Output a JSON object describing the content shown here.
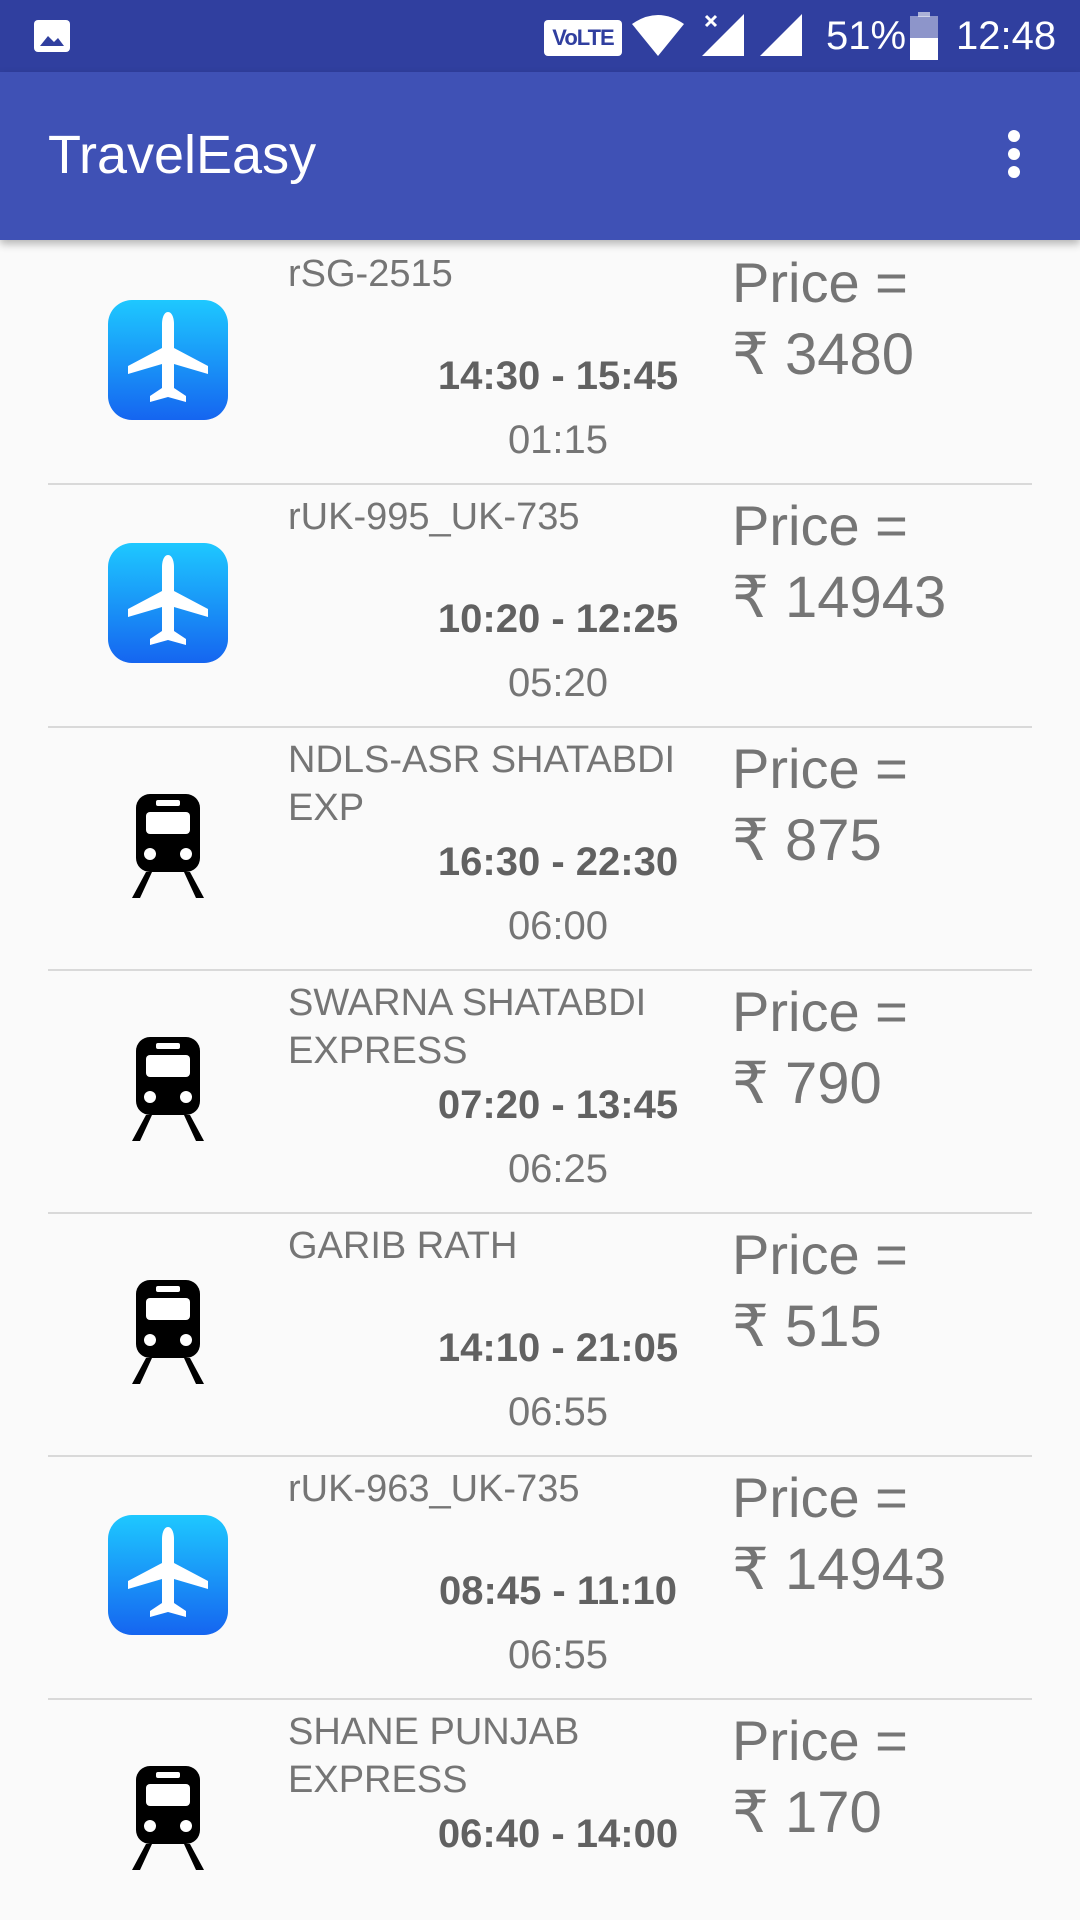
{
  "status_bar": {
    "volte": "VoLTE",
    "battery": "51%",
    "time": "12:48",
    "icons": [
      "gallery-icon",
      "wifi-icon",
      "cell-signal-icon",
      "cell-signal-icon",
      "battery-icon"
    ]
  },
  "app_bar": {
    "title": "TravelEasy",
    "menu_icon": "more-vert-icon"
  },
  "colors": {
    "status_bar": "#303f9f",
    "app_bar": "#3f51b5",
    "flight_icon_gradient": [
      "#1ec8ff",
      "#1565f0"
    ],
    "text_gray": "#757575"
  },
  "items": [
    {
      "type": "flight",
      "icon": "airplane-icon",
      "name": "rSG-2515",
      "time": "14:30 - 15:45",
      "duration": "01:15",
      "price_label": "Price =",
      "price": "₹ 3480"
    },
    {
      "type": "flight",
      "icon": "airplane-icon",
      "name": "rUK-995_UK-735",
      "time": "10:20 - 12:25",
      "duration": "05:20",
      "price_label": "Price =",
      "price": "₹ 14943"
    },
    {
      "type": "train",
      "icon": "train-icon",
      "name": "NDLS-ASR SHATABDI EXP",
      "time": "16:30 - 22:30",
      "duration": "06:00",
      "price_label": "Price =",
      "price": "₹ 875"
    },
    {
      "type": "train",
      "icon": "train-icon",
      "name": "SWARNA SHATABDI EXPRESS",
      "time": "07:20 - 13:45",
      "duration": "06:25",
      "price_label": "Price =",
      "price": "₹ 790"
    },
    {
      "type": "train",
      "icon": "train-icon",
      "name": "GARIB RATH",
      "time": "14:10 - 21:05",
      "duration": "06:55",
      "price_label": "Price =",
      "price": "₹ 515"
    },
    {
      "type": "flight",
      "icon": "airplane-icon",
      "name": "rUK-963_UK-735",
      "time": "08:45 - 11:10",
      "duration": "06:55",
      "price_label": "Price =",
      "price": "₹ 14943"
    },
    {
      "type": "train",
      "icon": "train-icon",
      "name": "SHANE PUNJAB EXPRESS",
      "time": "06:40 - 14:00",
      "duration": "",
      "price_label": "Price =",
      "price": "₹ 170"
    }
  ]
}
